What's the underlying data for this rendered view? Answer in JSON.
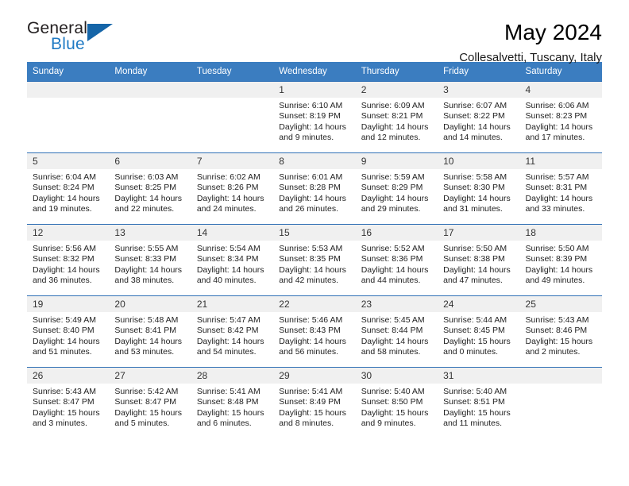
{
  "brand": {
    "name_top": "General",
    "name_bottom": "Blue",
    "accent_color": "#1565a8",
    "text_color": "#231f20",
    "blue_text_color": "#1f7ac4"
  },
  "header": {
    "title": "May 2024",
    "subtitle": "Collesalvetti, Tuscany, Italy",
    "header_bg": "#3b7dc0",
    "row_divider": "#2f6fb5",
    "daynum_bg": "#f0f0f0"
  },
  "weekdays": [
    "Sunday",
    "Monday",
    "Tuesday",
    "Wednesday",
    "Thursday",
    "Friday",
    "Saturday"
  ],
  "labels": {
    "sunrise": "Sunrise:",
    "sunset": "Sunset:",
    "daylight": "Daylight:"
  },
  "weeks": [
    [
      {
        "day": ""
      },
      {
        "day": ""
      },
      {
        "day": ""
      },
      {
        "day": "1",
        "sunrise": "Sunrise: 6:10 AM",
        "sunset": "Sunset: 8:19 PM",
        "daylight": "Daylight: 14 hours and 9 minutes."
      },
      {
        "day": "2",
        "sunrise": "Sunrise: 6:09 AM",
        "sunset": "Sunset: 8:21 PM",
        "daylight": "Daylight: 14 hours and 12 minutes."
      },
      {
        "day": "3",
        "sunrise": "Sunrise: 6:07 AM",
        "sunset": "Sunset: 8:22 PM",
        "daylight": "Daylight: 14 hours and 14 minutes."
      },
      {
        "day": "4",
        "sunrise": "Sunrise: 6:06 AM",
        "sunset": "Sunset: 8:23 PM",
        "daylight": "Daylight: 14 hours and 17 minutes."
      }
    ],
    [
      {
        "day": "5",
        "sunrise": "Sunrise: 6:04 AM",
        "sunset": "Sunset: 8:24 PM",
        "daylight": "Daylight: 14 hours and 19 minutes."
      },
      {
        "day": "6",
        "sunrise": "Sunrise: 6:03 AM",
        "sunset": "Sunset: 8:25 PM",
        "daylight": "Daylight: 14 hours and 22 minutes."
      },
      {
        "day": "7",
        "sunrise": "Sunrise: 6:02 AM",
        "sunset": "Sunset: 8:26 PM",
        "daylight": "Daylight: 14 hours and 24 minutes."
      },
      {
        "day": "8",
        "sunrise": "Sunrise: 6:01 AM",
        "sunset": "Sunset: 8:28 PM",
        "daylight": "Daylight: 14 hours and 26 minutes."
      },
      {
        "day": "9",
        "sunrise": "Sunrise: 5:59 AM",
        "sunset": "Sunset: 8:29 PM",
        "daylight": "Daylight: 14 hours and 29 minutes."
      },
      {
        "day": "10",
        "sunrise": "Sunrise: 5:58 AM",
        "sunset": "Sunset: 8:30 PM",
        "daylight": "Daylight: 14 hours and 31 minutes."
      },
      {
        "day": "11",
        "sunrise": "Sunrise: 5:57 AM",
        "sunset": "Sunset: 8:31 PM",
        "daylight": "Daylight: 14 hours and 33 minutes."
      }
    ],
    [
      {
        "day": "12",
        "sunrise": "Sunrise: 5:56 AM",
        "sunset": "Sunset: 8:32 PM",
        "daylight": "Daylight: 14 hours and 36 minutes."
      },
      {
        "day": "13",
        "sunrise": "Sunrise: 5:55 AM",
        "sunset": "Sunset: 8:33 PM",
        "daylight": "Daylight: 14 hours and 38 minutes."
      },
      {
        "day": "14",
        "sunrise": "Sunrise: 5:54 AM",
        "sunset": "Sunset: 8:34 PM",
        "daylight": "Daylight: 14 hours and 40 minutes."
      },
      {
        "day": "15",
        "sunrise": "Sunrise: 5:53 AM",
        "sunset": "Sunset: 8:35 PM",
        "daylight": "Daylight: 14 hours and 42 minutes."
      },
      {
        "day": "16",
        "sunrise": "Sunrise: 5:52 AM",
        "sunset": "Sunset: 8:36 PM",
        "daylight": "Daylight: 14 hours and 44 minutes."
      },
      {
        "day": "17",
        "sunrise": "Sunrise: 5:50 AM",
        "sunset": "Sunset: 8:38 PM",
        "daylight": "Daylight: 14 hours and 47 minutes."
      },
      {
        "day": "18",
        "sunrise": "Sunrise: 5:50 AM",
        "sunset": "Sunset: 8:39 PM",
        "daylight": "Daylight: 14 hours and 49 minutes."
      }
    ],
    [
      {
        "day": "19",
        "sunrise": "Sunrise: 5:49 AM",
        "sunset": "Sunset: 8:40 PM",
        "daylight": "Daylight: 14 hours and 51 minutes."
      },
      {
        "day": "20",
        "sunrise": "Sunrise: 5:48 AM",
        "sunset": "Sunset: 8:41 PM",
        "daylight": "Daylight: 14 hours and 53 minutes."
      },
      {
        "day": "21",
        "sunrise": "Sunrise: 5:47 AM",
        "sunset": "Sunset: 8:42 PM",
        "daylight": "Daylight: 14 hours and 54 minutes."
      },
      {
        "day": "22",
        "sunrise": "Sunrise: 5:46 AM",
        "sunset": "Sunset: 8:43 PM",
        "daylight": "Daylight: 14 hours and 56 minutes."
      },
      {
        "day": "23",
        "sunrise": "Sunrise: 5:45 AM",
        "sunset": "Sunset: 8:44 PM",
        "daylight": "Daylight: 14 hours and 58 minutes."
      },
      {
        "day": "24",
        "sunrise": "Sunrise: 5:44 AM",
        "sunset": "Sunset: 8:45 PM",
        "daylight": "Daylight: 15 hours and 0 minutes."
      },
      {
        "day": "25",
        "sunrise": "Sunrise: 5:43 AM",
        "sunset": "Sunset: 8:46 PM",
        "daylight": "Daylight: 15 hours and 2 minutes."
      }
    ],
    [
      {
        "day": "26",
        "sunrise": "Sunrise: 5:43 AM",
        "sunset": "Sunset: 8:47 PM",
        "daylight": "Daylight: 15 hours and 3 minutes."
      },
      {
        "day": "27",
        "sunrise": "Sunrise: 5:42 AM",
        "sunset": "Sunset: 8:47 PM",
        "daylight": "Daylight: 15 hours and 5 minutes."
      },
      {
        "day": "28",
        "sunrise": "Sunrise: 5:41 AM",
        "sunset": "Sunset: 8:48 PM",
        "daylight": "Daylight: 15 hours and 6 minutes."
      },
      {
        "day": "29",
        "sunrise": "Sunrise: 5:41 AM",
        "sunset": "Sunset: 8:49 PM",
        "daylight": "Daylight: 15 hours and 8 minutes."
      },
      {
        "day": "30",
        "sunrise": "Sunrise: 5:40 AM",
        "sunset": "Sunset: 8:50 PM",
        "daylight": "Daylight: 15 hours and 9 minutes."
      },
      {
        "day": "31",
        "sunrise": "Sunrise: 5:40 AM",
        "sunset": "Sunset: 8:51 PM",
        "daylight": "Daylight: 15 hours and 11 minutes."
      },
      {
        "day": ""
      }
    ]
  ]
}
